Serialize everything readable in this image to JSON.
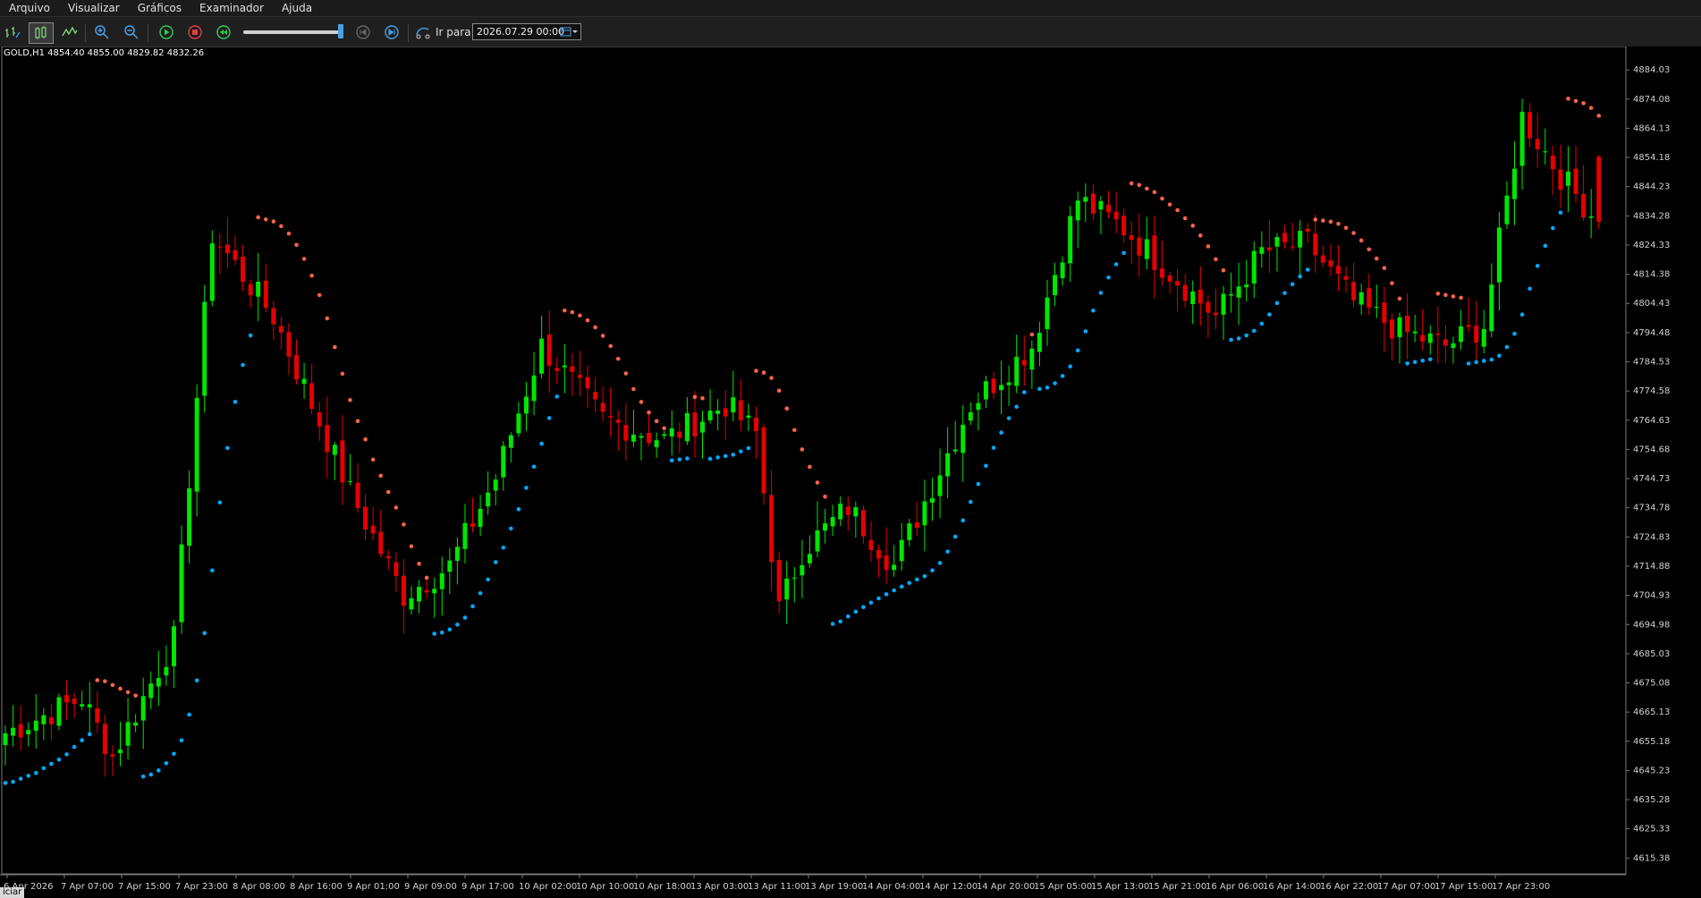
{
  "menu": [
    "Arquivo",
    "Visualizar",
    "Gráficos",
    "Examinador",
    "Ajuda"
  ],
  "toolbar": {
    "icons": [
      "bar-chart-icon",
      "candlestick-icon",
      "line-chart-icon",
      "zoom-in-icon",
      "zoom-out-icon",
      "play-icon",
      "stop-icon",
      "rewind-icon",
      "speed-slider",
      "step-back-icon",
      "step-forward-icon",
      "goto-icon",
      "calendar-icon"
    ],
    "goto_label": "Ir para",
    "date_value": "2026.07.29 00:00"
  },
  "chart": {
    "symbol_info": "GOLD,H1  4854.40 4855.00 4829.82 4832.26",
    "start_tag": "iciar"
  },
  "colors": {
    "bull": "#00e600",
    "bear": "#e60000",
    "sar_up": "#00aaff",
    "sar_down": "#ff6347",
    "axis_text": "#d0d0d0"
  },
  "chart_data": {
    "type": "candlestick",
    "symbol": "GOLD",
    "timeframe": "H1",
    "ylim": [
      4610,
      4892
    ],
    "y_ticks": [
      "4884.03",
      "4874.08",
      "4864.13",
      "4854.18",
      "4844.23",
      "4834.28",
      "4824.33",
      "4814.38",
      "4804.43",
      "4794.48",
      "4784.53",
      "4774.58",
      "4764.63",
      "4754.68",
      "4744.73",
      "4734.78",
      "4724.83",
      "4714.88",
      "4704.93",
      "4694.98",
      "4685.03",
      "4675.08",
      "4665.13",
      "4655.18",
      "4645.23",
      "4635.28",
      "4625.33",
      "4615.38"
    ],
    "x_labels": [
      "6 Apr 2026",
      "7 Apr 07:00",
      "7 Apr 15:00",
      "7 Apr 23:00",
      "8 Apr 08:00",
      "8 Apr 16:00",
      "9 Apr 01:00",
      "9 Apr 09:00",
      "9 Apr 17:00",
      "10 Apr 02:00",
      "10 Apr 10:00",
      "10 Apr 18:00",
      "13 Apr 03:00",
      "13 Apr 11:00",
      "13 Apr 19:00",
      "14 Apr 04:00",
      "14 Apr 12:00",
      "14 Apr 20:00",
      "15 Apr 05:00",
      "15 Apr 13:00",
      "15 Apr 21:00",
      "16 Apr 06:00",
      "16 Apr 14:00",
      "16 Apr 22:00",
      "17 Apr 07:00",
      "17 Apr 15:00",
      "17 Apr 23:00"
    ],
    "last_bar": {
      "open": 4854.4,
      "high": 4855.0,
      "low": 4829.82,
      "close": 4832.26
    },
    "anchors": [
      [
        0,
        4658
      ],
      [
        10,
        4670
      ],
      [
        14,
        4650
      ],
      [
        18,
        4670
      ],
      [
        22,
        4690
      ],
      [
        27,
        4828
      ],
      [
        35,
        4800
      ],
      [
        45,
        4740
      ],
      [
        52,
        4705
      ],
      [
        58,
        4715
      ],
      [
        64,
        4745
      ],
      [
        70,
        4790
      ],
      [
        78,
        4765
      ],
      [
        86,
        4758
      ],
      [
        94,
        4770
      ],
      [
        98,
        4760
      ],
      [
        101,
        4700
      ],
      [
        104,
        4720
      ],
      [
        110,
        4735
      ],
      [
        116,
        4715
      ],
      [
        126,
        4770
      ],
      [
        134,
        4790
      ],
      [
        140,
        4840
      ],
      [
        146,
        4830
      ],
      [
        152,
        4815
      ],
      [
        158,
        4800
      ],
      [
        164,
        4822
      ],
      [
        170,
        4825
      ],
      [
        176,
        4805
      ],
      [
        182,
        4795
      ],
      [
        188,
        4790
      ],
      [
        193,
        4797
      ],
      [
        198,
        4868
      ],
      [
        203,
        4848
      ],
      [
        208,
        4832
      ]
    ]
  }
}
